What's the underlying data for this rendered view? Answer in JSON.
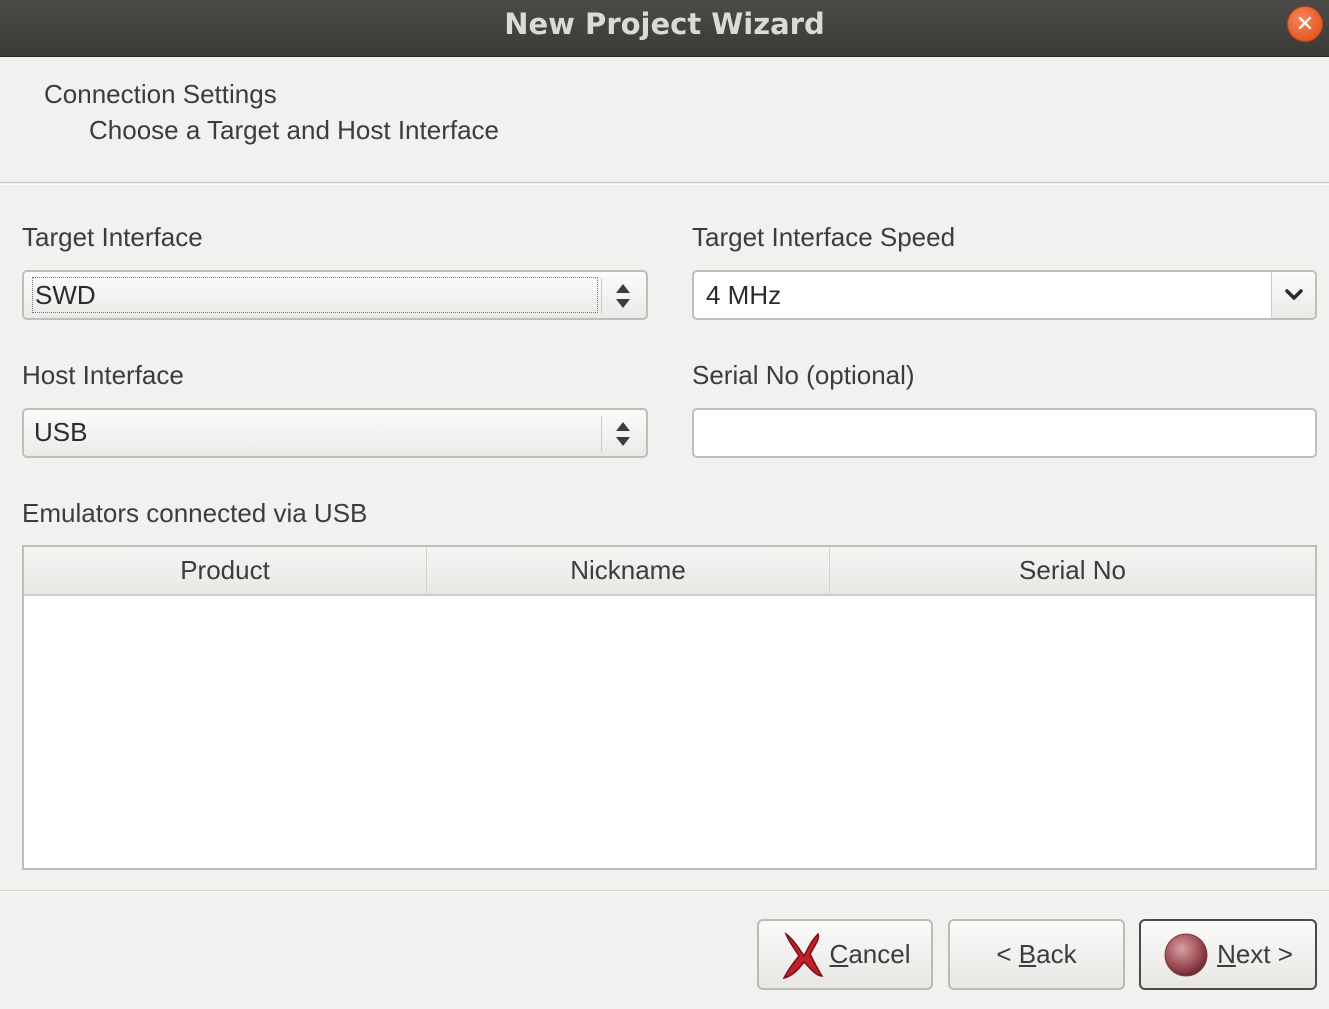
{
  "window": {
    "title": "New Project Wizard"
  },
  "header": {
    "title": "Connection Settings",
    "subtitle": "Choose a Target and Host Interface"
  },
  "form": {
    "target_interface": {
      "label": "Target Interface",
      "value": "SWD"
    },
    "target_interface_speed": {
      "label": "Target Interface Speed",
      "value": "4 MHz"
    },
    "host_interface": {
      "label": "Host Interface",
      "value": "USB"
    },
    "serial_no": {
      "label": "Serial No (optional)",
      "value": ""
    }
  },
  "emulators": {
    "label": "Emulators connected via USB",
    "columns": [
      "Product",
      "Nickname",
      "Serial No"
    ],
    "rows": []
  },
  "buttons": {
    "cancel": {
      "mnemonic": "C",
      "rest": "ancel"
    },
    "back": {
      "prefix": "< ",
      "mnemonic": "B",
      "rest": "ack"
    },
    "next": {
      "mnemonic": "N",
      "rest": "ext >"
    }
  },
  "icons": {
    "close": "close-icon",
    "cancel": "red-x-icon",
    "next": "red-circle-icon"
  },
  "colors": {
    "titlebar": "#3f3e3a",
    "close_button": "#e55a26",
    "cancel_icon": "#c0202a"
  }
}
